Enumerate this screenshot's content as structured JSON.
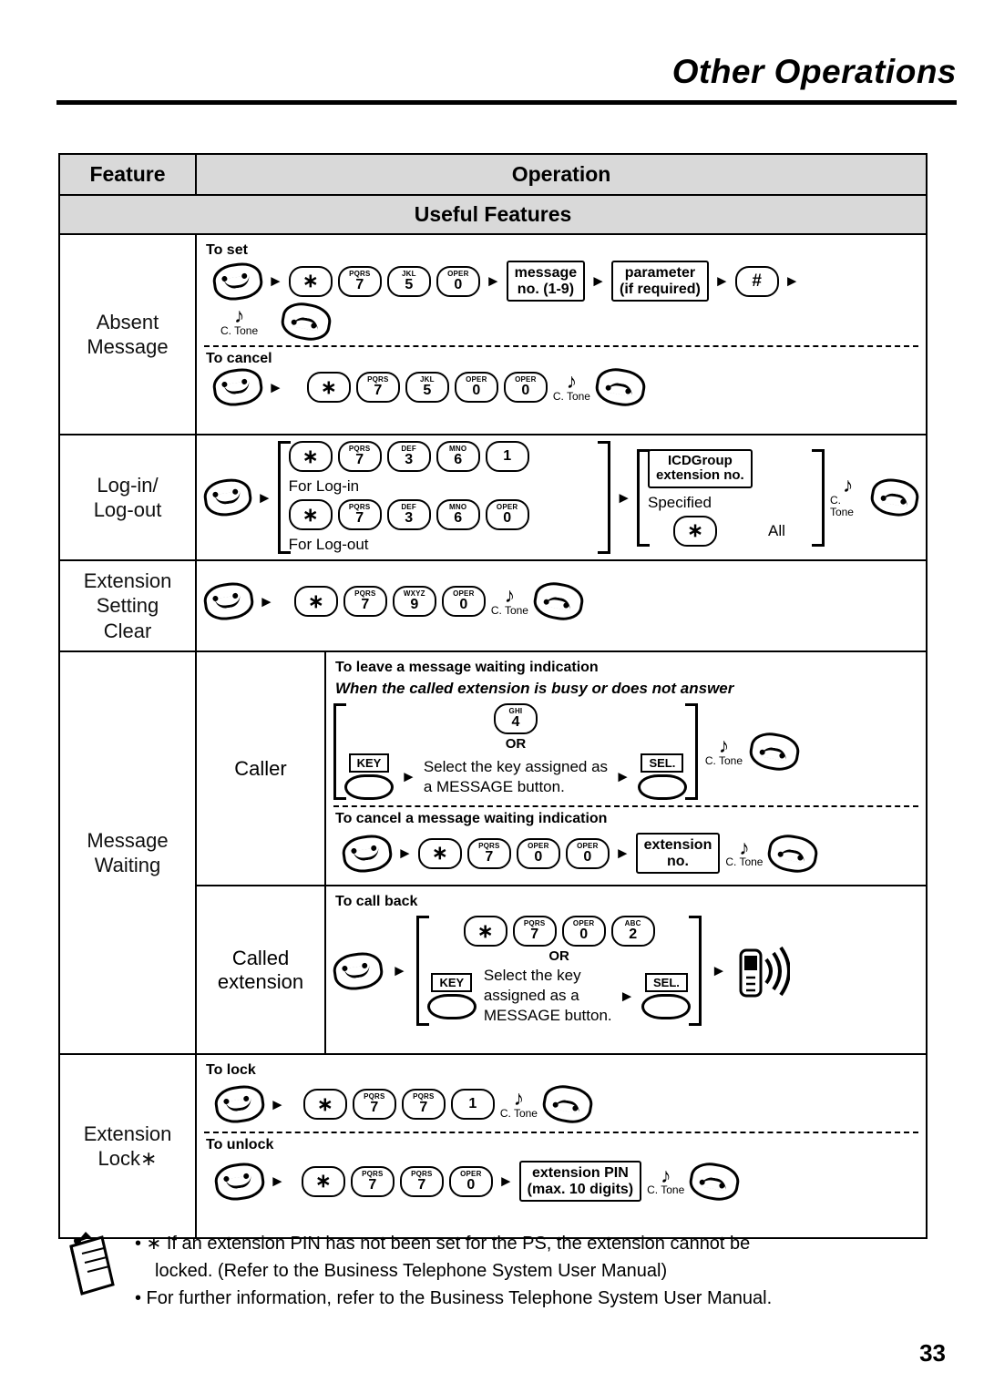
{
  "header": {
    "title": "Other Operations"
  },
  "table": {
    "col_feature": "Feature",
    "col_operation": "Operation",
    "band": "Useful Features",
    "rows": [
      {
        "feature": [
          "Absent",
          "Message"
        ],
        "sub1": "To set",
        "seq1": [
          "talk",
          "arrow",
          "*",
          "PQRS 7",
          "JKL 5",
          "OPER 0",
          "arrow"
        ],
        "box1": "message\nno. (1-9)",
        "box2": "parameter\n(if required)",
        "key_hash": "#",
        "tone": "C. Tone",
        "sub2": "To cancel",
        "seq2": [
          "talk",
          "arrow",
          "*",
          "PQRS 7",
          "JKL 5",
          "OPER 0",
          "OPER 0"
        ]
      },
      {
        "feature": [
          "Log-in/",
          "Log-out"
        ],
        "line_login": "For Log-in",
        "line_logout": "For Log-out",
        "icd_group": "ICDGroup\nextension no.",
        "specified": "Specified",
        "all": "All",
        "tone": "C. Tone"
      },
      {
        "feature": [
          "Extension",
          "Setting",
          "Clear"
        ],
        "tone": "C. Tone"
      },
      {
        "feature": [
          "Message",
          "Waiting"
        ],
        "sub_caller": "Caller",
        "title1": "To leave a message waiting indication",
        "italic1": "When the called extension is busy or does not answer",
        "key_ghi4": "GHI 4",
        "or": "OR",
        "key_label": "KEY",
        "sel_label": "SEL.",
        "text1": "Select the key assigned as",
        "text2": "a MESSAGE button.",
        "tone": "C. Tone",
        "title2": "To cancel a message waiting indication",
        "box_ext": "extension\nno.",
        "sub_called": "Called\nextension",
        "title3": "To call back",
        "text3a": "Select the key",
        "text3b": "assigned as a",
        "text3c": "MESSAGE button."
      },
      {
        "feature": [
          "Extension",
          "Lock∗"
        ],
        "sub1": "To lock",
        "sub2": "To unlock",
        "box_pin": "extension PIN\n(max. 10 digits)",
        "tone": "C. Tone"
      }
    ]
  },
  "notes": {
    "line1": "• ∗ If an extension PIN has not been set for the PS, the extension cannot be",
    "line2": "locked. (Refer to the Business Telephone System User Manual)",
    "line3": "• For further information, refer to the Business Telephone System User Manual."
  },
  "page_number": "33",
  "keys": {
    "star": "∗",
    "hash": "#",
    "pqrs": "PQRS",
    "pqrs_num": "7",
    "jkl": "JKL",
    "jkl_num": "5",
    "oper": "OPER",
    "oper_num": "0",
    "def": "DEF",
    "def_num": "3",
    "mno": "MNO",
    "mno_num": "6",
    "one": "1",
    "wxyz": "WXYZ",
    "wxyz_num": "9",
    "ghi": "GHI",
    "ghi_num": "4",
    "abc": "ABC",
    "abc_num": "2"
  }
}
